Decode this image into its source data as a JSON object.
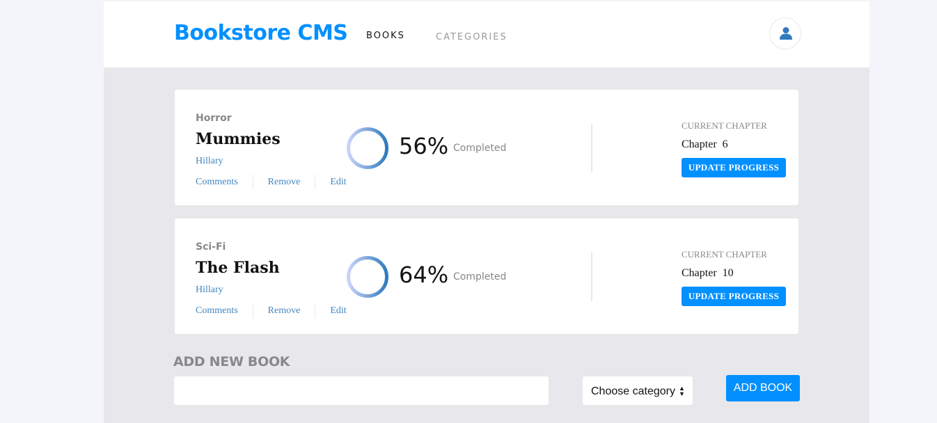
{
  "header": {
    "brand": "Bookstore CMS",
    "nav": [
      {
        "label": "BOOKS",
        "active": true
      },
      {
        "label": "CATEGORIES",
        "active": false
      }
    ],
    "user_icon": "user-icon"
  },
  "books": [
    {
      "genre": "Horror",
      "title": "Mummies",
      "author": "Hillary",
      "actions": {
        "comments": "Comments",
        "remove": "Remove",
        "edit": "Edit"
      },
      "percent": 56,
      "percent_label": "56%",
      "completed_label": "Completed",
      "chapter_label": "CURRENT CHAPTER",
      "chapter": "Chapter  6",
      "update_label": "UPDATE PROGRESS"
    },
    {
      "genre": "Sci-Fi",
      "title": "The Flash",
      "author": "Hillary",
      "actions": {
        "comments": "Comments",
        "remove": "Remove",
        "edit": "Edit"
      },
      "percent": 64,
      "percent_label": "64%",
      "completed_label": "Completed",
      "chapter_label": "CURRENT CHAPTER",
      "chapter": "Chapter  10",
      "update_label": "UPDATE PROGRESS"
    }
  ],
  "add_form": {
    "title": "ADD NEW BOOK",
    "input_value": "",
    "input_placeholder": "",
    "category_selected": "Choose category",
    "button_label": "ADD BOOK"
  },
  "colors": {
    "primary": "#0290ff",
    "progress": "#307bbe",
    "background": "#e8e8ec"
  }
}
